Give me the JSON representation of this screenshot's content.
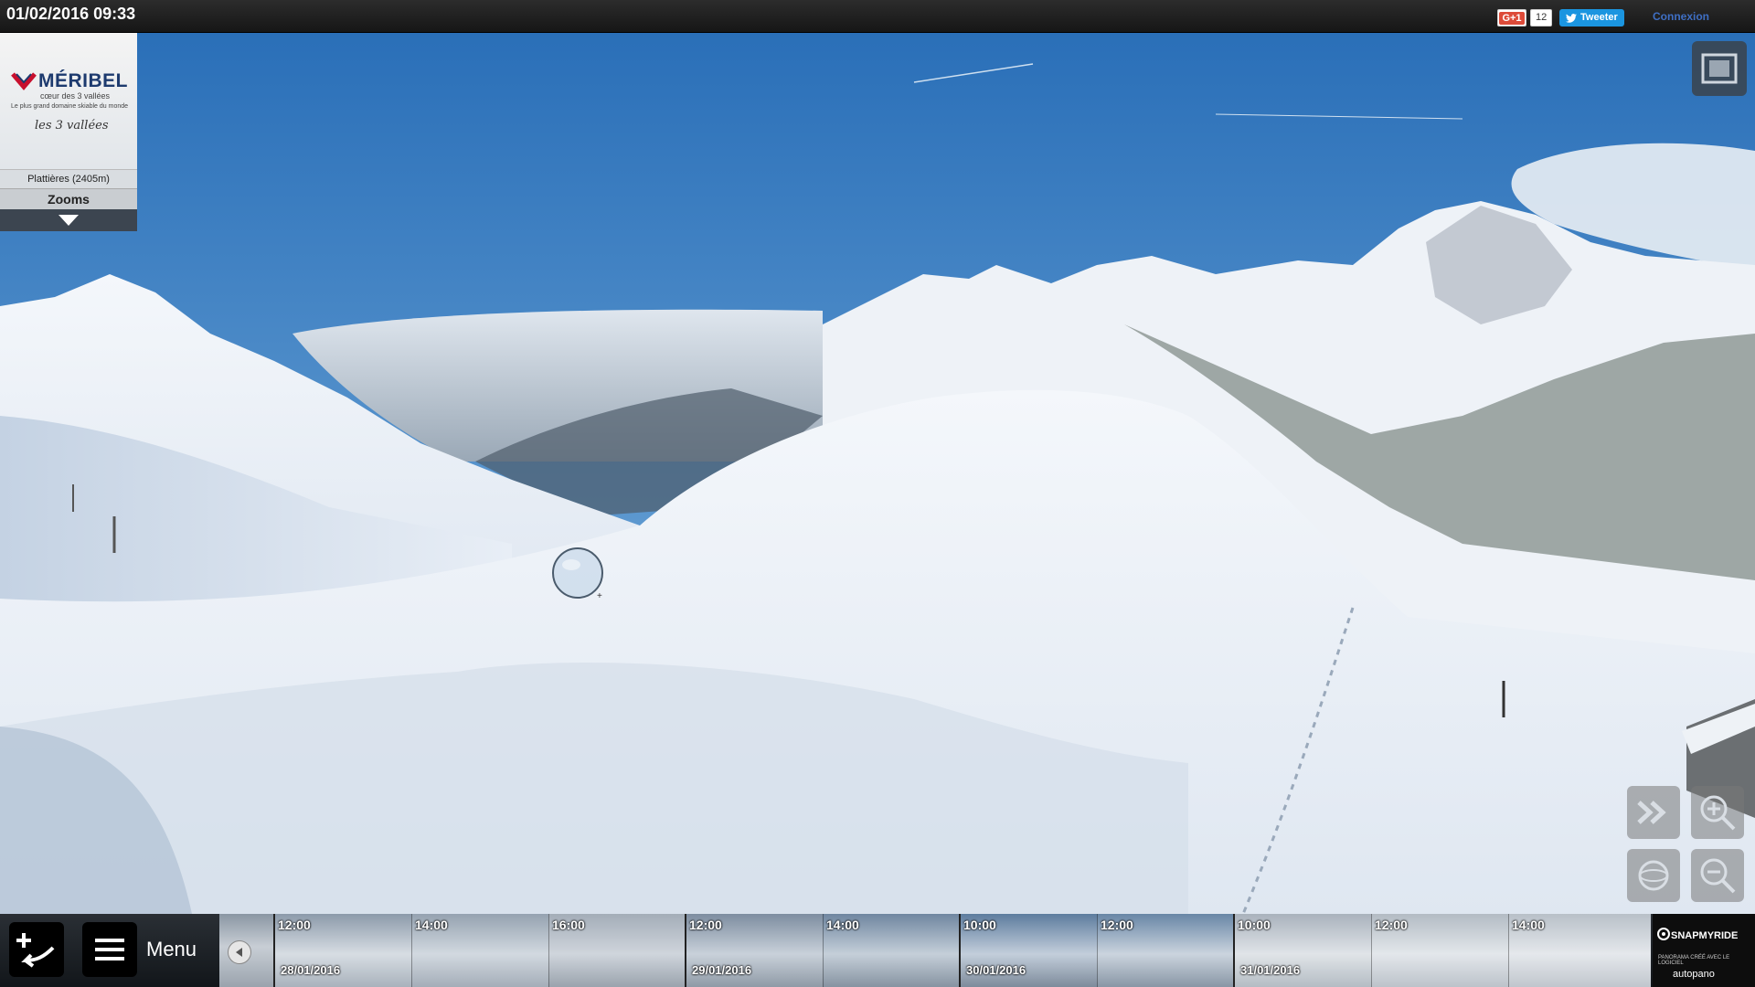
{
  "topbar": {
    "datetime": "01/02/2016 09:33",
    "gplus_label": "G+1",
    "gplus_count": "12",
    "tweet_label": "Tweeter",
    "connexion_label": "Connexion"
  },
  "logo_panel": {
    "brand": "MÉRIBEL",
    "brand_sub": "cœur des 3 vallées",
    "tagline": "Le plus grand domaine skiable du monde",
    "partner": "les 3 vallées",
    "station": "Plattières (2405m)",
    "zooms_label": "Zooms"
  },
  "bottombar": {
    "menu_label": "Menu",
    "timeline": [
      {
        "time": "12:00",
        "date": "28/01/2016"
      },
      {
        "time": "14:00",
        "date": ""
      },
      {
        "time": "16:00",
        "date": ""
      },
      {
        "time": "12:00",
        "date": "29/01/2016"
      },
      {
        "time": "14:00",
        "date": ""
      },
      {
        "time": "10:00",
        "date": "30/01/2016"
      },
      {
        "time": "12:00",
        "date": ""
      },
      {
        "time": "10:00",
        "date": "31/01/2016"
      },
      {
        "time": "12:00",
        "date": ""
      },
      {
        "time": "14:00",
        "date": ""
      }
    ],
    "snap_title": "SNAPMYRIDE",
    "snap_sub": "PANORAMA CRÉÉ AVEC LE LOGICIEL",
    "snap_auto": "autopano"
  },
  "colors": {
    "sky_top": "#2a6fb8",
    "sky_bottom": "#9cc4e4",
    "tweet_blue": "#1b95e0",
    "gplus_red": "#dd4b39",
    "connexion_blue": "#3f6fc4"
  }
}
